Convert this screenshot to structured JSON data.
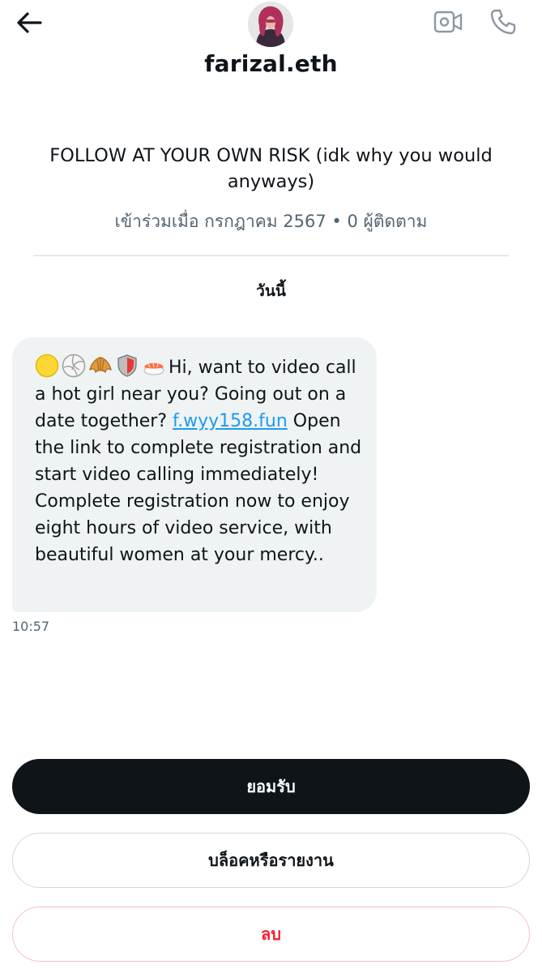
{
  "header": {
    "username": "farizal.eth",
    "icons": {
      "back": "arrow-left-icon",
      "video": "video-camera-icon",
      "phone": "phone-icon"
    }
  },
  "profile": {
    "bio": "FOLLOW AT YOUR OWN RISK (idk why you would anyways)",
    "joined": "เข้าร่วมเมื่อ กรกฎาคม 2567 • 0 ผู้ติดตาม"
  },
  "conversation": {
    "date_label": "วันนี้",
    "message": {
      "emojis": [
        "yellow-circle-emoji",
        "volleyball-emoji",
        "croissant-emoji",
        "shield-emoji",
        "sushi-emoji"
      ],
      "text_before_link": "Hi, want to video call a hot girl near you? Going out on a date together? ",
      "link": "f.wyy158.fun",
      "text_after_link": " Open the link to complete registration and start video calling immediately! Complete registration now to enjoy eight hours of video service, with beautiful women at your mercy..",
      "time": "10:57"
    }
  },
  "actions": {
    "accept_label": "ยอมรับ",
    "block_report_label": "บล็อคหรือรายงาน",
    "delete_label": "ลบ"
  },
  "colors": {
    "link": "#1d9bf0",
    "delete": "#f4212e",
    "accept_bg": "#0f1419",
    "bubble_bg": "#eff3f4"
  }
}
